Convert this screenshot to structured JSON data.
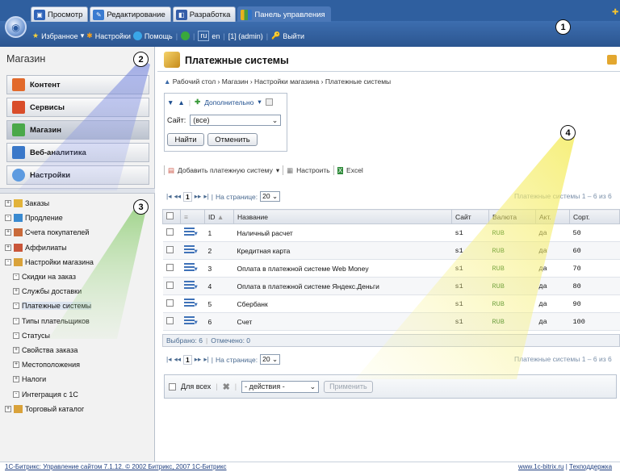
{
  "topbar": {
    "tabs": [
      {
        "label": "Просмотр",
        "icon": "view-icon"
      },
      {
        "label": "Редактирование",
        "icon": "edit-icon"
      },
      {
        "label": "Разработка",
        "icon": "dev-icon"
      },
      {
        "label": "Панель управления",
        "icon": "control-panel-icon",
        "active": true
      }
    ],
    "nav": {
      "favorites": "Избранное",
      "settings": "Настройки",
      "help": "Помощь",
      "lang_ru": "ru",
      "lang_en": "en",
      "user": "[1] (admin)",
      "logout": "Выйти"
    }
  },
  "callouts": [
    "1",
    "2",
    "3",
    "4"
  ],
  "sidebar": {
    "title": "Магазин",
    "menu": [
      {
        "label": "Контент",
        "color": "#e26a2c"
      },
      {
        "label": "Сервисы",
        "color": "#d94d2a"
      },
      {
        "label": "Магазин",
        "color": "#4aa84a",
        "selected": true
      },
      {
        "label": "Веб-аналитика",
        "color": "#3a78c9"
      },
      {
        "label": "Настройки",
        "color": "#5d9be0"
      }
    ],
    "tree": [
      {
        "label": "Заказы",
        "box": "+",
        "level": 0
      },
      {
        "label": "Продление",
        "box": "-",
        "level": 0
      },
      {
        "label": "Счета покупателей",
        "box": "+",
        "level": 0
      },
      {
        "label": "Аффилиаты",
        "box": "+",
        "level": 0
      },
      {
        "label": "Настройки магазина",
        "box": "-",
        "level": 0
      },
      {
        "label": "Скидки на заказ",
        "box": "-",
        "level": 1
      },
      {
        "label": "Службы доставки",
        "box": "+",
        "level": 1
      },
      {
        "label": "Платежные системы",
        "box": "-",
        "level": 1,
        "selected": true
      },
      {
        "label": "Типы плательщиков",
        "box": "-",
        "level": 1
      },
      {
        "label": "Статусы",
        "box": "-",
        "level": 1
      },
      {
        "label": "Свойства заказа",
        "box": "+",
        "level": 1
      },
      {
        "label": "Местоположения",
        "box": "+",
        "level": 1
      },
      {
        "label": "Налоги",
        "box": "+",
        "level": 1
      },
      {
        "label": "Интеграция с 1С",
        "box": "-",
        "level": 1
      },
      {
        "label": "Торговый каталог",
        "box": "+",
        "level": 0
      }
    ]
  },
  "page": {
    "title": "Платежные системы",
    "breadcrumb": "Рабочий стол › Магазин › Настройки магазина › Платежные системы",
    "filter": {
      "more": "Дополнительно",
      "site_label": "Сайт:",
      "site_value": "(все)",
      "find": "Найти",
      "cancel": "Отменить"
    },
    "toolbar": {
      "add": "Добавить платежную систему",
      "configure": "Настроить",
      "excel": "Excel"
    },
    "pager": {
      "page": "1",
      "per_page_label": "На странице:",
      "per_page": "20",
      "total": "Платежные системы 1 – 6 из 6"
    },
    "columns": [
      "ID",
      "Название",
      "Сайт",
      "Валюта",
      "Акт.",
      "Сорт."
    ],
    "rows": [
      {
        "id": "1",
        "name": "Наличный расчет",
        "site": "s1",
        "currency": "RUB",
        "active": "да",
        "sort": "50"
      },
      {
        "id": "2",
        "name": "Кредитная карта",
        "site": "s1",
        "currency": "RUB",
        "active": "да",
        "sort": "60"
      },
      {
        "id": "3",
        "name": "Оплата в платежной системе Web Money",
        "site": "s1",
        "currency": "RUB",
        "active": "да",
        "sort": "70"
      },
      {
        "id": "4",
        "name": "Оплата в платежной системе Яндекс.Деньги",
        "site": "s1",
        "currency": "RUB",
        "active": "да",
        "sort": "80"
      },
      {
        "id": "5",
        "name": "Сбербанк",
        "site": "s1",
        "currency": "RUB",
        "active": "да",
        "sort": "90"
      },
      {
        "id": "6",
        "name": "Счет",
        "site": "s1",
        "currency": "RUB",
        "active": "да",
        "sort": "100"
      }
    ],
    "selection": {
      "selected": "Выбрано: 6",
      "checked": "Отмечено: 0"
    },
    "actions": {
      "for_all": "Для всех",
      "actions": "- действия -",
      "apply": "Применить"
    }
  },
  "footer": {
    "left": "1С-Битрикс: Управление сайтом 7.1.12. © 2002 Битрикс, 2007 1С-Битрикс",
    "link1": "www.1c-bitrix.ru",
    "link2": "Техподдержка"
  },
  "colors": {
    "accent": "#2f5f9f",
    "link": "#1f4f8f",
    "currency": "#1a6f1a"
  }
}
